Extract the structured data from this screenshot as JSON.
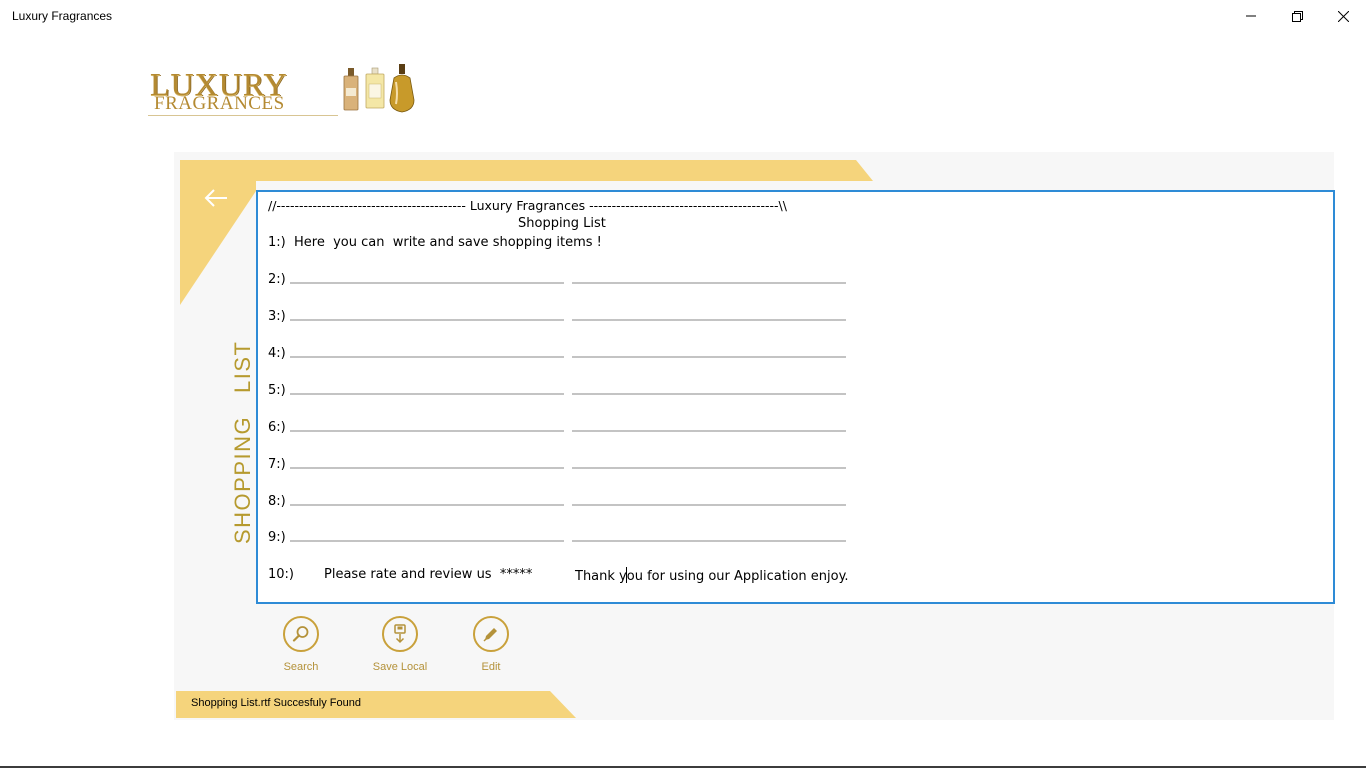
{
  "window": {
    "title": "Luxury Fragrances"
  },
  "logo": {
    "line1": "LUXURY",
    "line2": "FRAGRANCES"
  },
  "panel": {
    "vertical_title": "SHOPPING   LIST"
  },
  "document": {
    "header_line": "//------------------------------------------ Luxury Fragrances ------------------------------------------\\\\",
    "subtitle": "Shopping List",
    "first_line": "1:)  Here  you can  write and save shopping items !",
    "rows": [
      "2:)",
      "3:)",
      "4:)",
      "5:)",
      "6:)",
      "7:)",
      "8:)",
      "9:)"
    ],
    "last_line_num": "10:)",
    "last_line_text": "Please rate and review us  *****",
    "last_line_text2_a": "Thank y",
    "last_line_text2_b": "ou for using our Application enjoy."
  },
  "actions": {
    "search_label": "Search",
    "save_label": "Save Local",
    "edit_label": "Edit"
  },
  "status": {
    "message": "Shopping List.rtf Succesfuly Found"
  },
  "colors": {
    "accent_gold": "#f5d47c",
    "label_gold": "#b4923a",
    "editor_border": "#2e8bd6"
  }
}
